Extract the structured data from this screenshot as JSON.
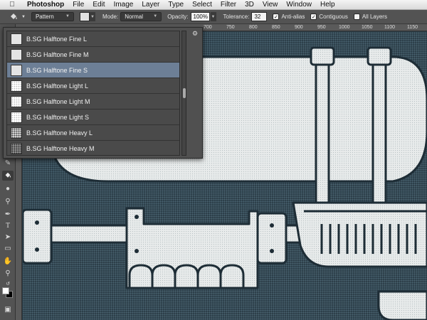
{
  "menubar": {
    "app": "Photoshop",
    "items": [
      "File",
      "Edit",
      "Image",
      "Layer",
      "Type",
      "Select",
      "Filter",
      "3D",
      "View",
      "Window",
      "Help"
    ]
  },
  "options": {
    "fill_source": "Pattern",
    "mode_label": "Mode:",
    "mode_value": "Normal",
    "opacity_label": "Opacity:",
    "opacity_value": "100%",
    "tolerance_label": "Tolerance:",
    "tolerance_value": "32",
    "anti_alias_label": "Anti-alias",
    "anti_alias_checked": true,
    "contiguous_label": "Contiguous",
    "contiguous_checked": true,
    "all_layers_label": "All Layers",
    "all_layers_checked": false
  },
  "ruler": {
    "labels": [
      "700",
      "750",
      "800",
      "850",
      "900",
      "950",
      "1000",
      "1050",
      "1100",
      "1150"
    ]
  },
  "toolbar": {
    "icons": [
      "eraser-icon",
      "paint-bucket-icon",
      "blur-icon",
      "dodge-icon",
      "pen-icon",
      "type-icon",
      "path-selection-icon",
      "rectangle-icon",
      "hand-icon",
      "zoom-icon",
      "swap-colors-icon",
      "quick-mask-icon"
    ]
  },
  "patterns": {
    "items": [
      {
        "label": "B.SG Halftone Fine L",
        "kind": "fine",
        "selected": false
      },
      {
        "label": "B.SG Halftone Fine M",
        "kind": "fine",
        "selected": false
      },
      {
        "label": "B.SG Halftone Fine S",
        "kind": "fine",
        "selected": true
      },
      {
        "label": "B.SG Halftone Light L",
        "kind": "light",
        "selected": false
      },
      {
        "label": "B.SG Halftone Light M",
        "kind": "light",
        "selected": false
      },
      {
        "label": "B.SG Halftone Light S",
        "kind": "light",
        "selected": false
      },
      {
        "label": "B.SG Halftone Heavy L",
        "kind": "heavy",
        "selected": false
      },
      {
        "label": "B.SG Halftone Heavy M",
        "kind": "heavym",
        "selected": false
      }
    ]
  },
  "colors": {
    "canvas_bg": "#2c3e49",
    "art_fill": "#e9ecec",
    "selection": "#6d7f96"
  }
}
